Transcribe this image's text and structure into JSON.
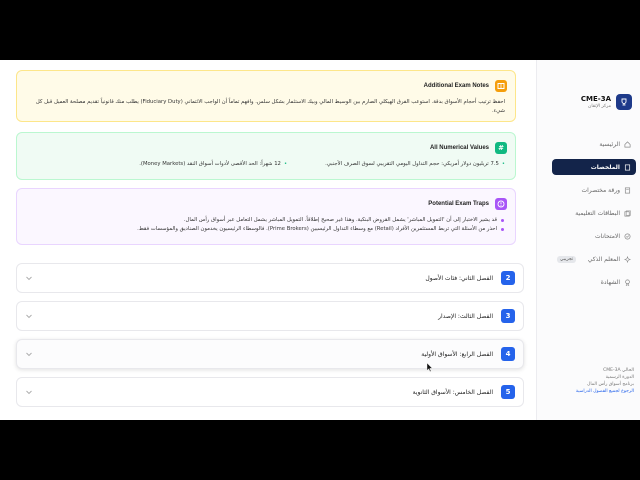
{
  "sidebar": {
    "brand_title": "CME-3A",
    "brand_subtitle": "مركز الإتقان",
    "items": [
      {
        "label": "الرئيسية",
        "icon": "home-icon"
      },
      {
        "label": "الملخصات",
        "icon": "book-icon"
      },
      {
        "label": "ورقة مختصرات",
        "icon": "sheet-icon"
      },
      {
        "label": "البطاقات التعليمية",
        "icon": "cards-icon"
      },
      {
        "label": "الامتحانات",
        "icon": "exam-icon"
      },
      {
        "label": "المعلم الذكي",
        "icon": "sparkle-icon",
        "badge": "تجريبي"
      },
      {
        "label": "الشهادة",
        "icon": "certificate-icon"
      }
    ],
    "footer": {
      "line1": "CME-3A الحالي",
      "line2": "الدورة الرسمية",
      "line3": "برنامج أسواق رأس المال",
      "link": "الرجوع لجميع الفصول الدراسية"
    }
  },
  "notes": {
    "title": "Additional Exam Notes",
    "body": "احفظ ترتيب أحجام الأسواق بدقة. استوعب الفرق الهيكلي الصارم بين الوسيط المالي وبيك الاستثمار بشكل سلس. وافهم تماماً أن الواجب الائتماني (Fiduciary Duty) يطلب منك قانونياً تقديم مصلحة العميل قبل كل شيء."
  },
  "values": {
    "title": "All Numerical Values",
    "items": [
      "7.5 تريليون دولار أمريكي: حجم التداول اليومي التقريبي لسوق الصرف الأجنبي.",
      "12 شهراً: الحد الأقصى لأدوات أسواق النقد (Money Markets)."
    ]
  },
  "traps": {
    "title": "Potential Exam Traps",
    "items": [
      "قد يشير الاختبار إلى أن 'التمويل المباشر' يشمل القروض البنكية. وهذا غير صحيح إطلاقاً. التمويل المباشر يشمل التعامل عبر أسواق رأس المال.",
      "احذر من الأسئلة التي تربط المستثمرين الأفراد (Retail) مع وسطاء التداول الرئيسيين (Prime Brokers). فالوسطاء الرئيسيون يخدمون الصناديق والمؤسسات فقط."
    ]
  },
  "chapters": [
    {
      "num": "2",
      "title": "الفصل الثاني: فئات الأصول"
    },
    {
      "num": "3",
      "title": "الفصل الثالث: الإصدار"
    },
    {
      "num": "4",
      "title": "الفصل الرابع: الأسواق الأولية"
    },
    {
      "num": "5",
      "title": "الفصل الخامس: الأسواق الثانوية"
    }
  ],
  "colors": {
    "accent": "#2563eb",
    "nav_active": "#13244a"
  }
}
